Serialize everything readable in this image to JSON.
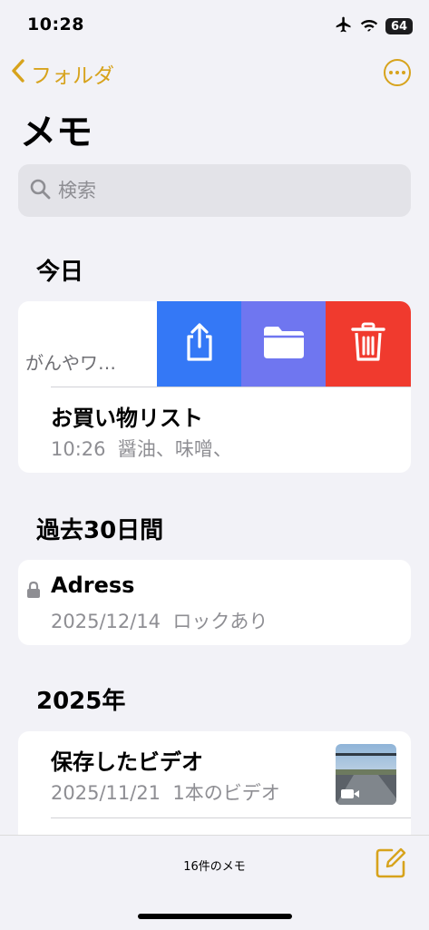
{
  "status": {
    "time": "10:28",
    "battery": "64"
  },
  "nav": {
    "back_label": "フォルダ"
  },
  "page": {
    "title": "メモ"
  },
  "search": {
    "placeholder": "検索"
  },
  "sections": [
    {
      "label": "今日"
    },
    {
      "label": "過去30日間"
    },
    {
      "label": "2025年"
    }
  ],
  "notes": [
    {
      "title_truncated": "がんやワ…"
    },
    {
      "title": "お買い物リスト",
      "time": "10:26",
      "preview": "醤油、味噌、"
    },
    {
      "title": "Adress",
      "date": "2025/12/14",
      "preview": "ロックあり",
      "locked": true
    },
    {
      "title": "保存したビデオ",
      "date": "2025/11/21",
      "preview": "1本のビデオ"
    }
  ],
  "swipe_actions": [
    {
      "name": "share",
      "color": "#3478f6"
    },
    {
      "name": "move-to-folder",
      "color": "#6f76f0"
    },
    {
      "name": "delete",
      "color": "#f03a2e"
    }
  ],
  "footer": {
    "count": "16件のメモ"
  },
  "colors": {
    "accent": "#d7a31c",
    "background": "#f2f2f7"
  }
}
